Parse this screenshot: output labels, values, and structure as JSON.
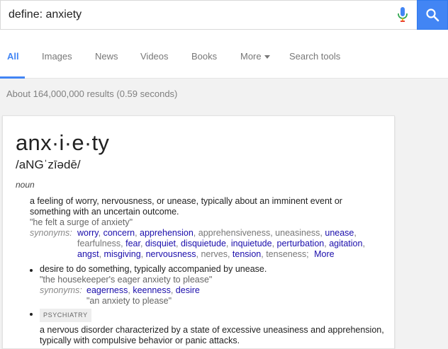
{
  "search": {
    "query": "define: anxiety"
  },
  "tabs": [
    {
      "label": "All",
      "active": true
    },
    {
      "label": "Images"
    },
    {
      "label": "News"
    },
    {
      "label": "Videos"
    },
    {
      "label": "Books"
    },
    {
      "label": "More"
    },
    {
      "label": "Search tools"
    }
  ],
  "stats": "About 164,000,000 results (0.59 seconds)",
  "definition": {
    "word": "anx·i·e·ty",
    "phonetic": "/aNGˈzīədē/",
    "part_of_speech": "noun",
    "senses": [
      {
        "text": "a feeling of worry, nervousness, or unease, typically about an imminent event or something with an uncertain outcome.",
        "example": "\"he felt a surge of anxiety\"",
        "synonyms_label": "synonyms:",
        "synonyms": [
          {
            "word": "worry",
            "link": true
          },
          {
            "word": "concern",
            "link": true
          },
          {
            "word": "apprehension",
            "link": true
          },
          {
            "word": "apprehensiveness",
            "link": false
          },
          {
            "word": "uneasiness",
            "link": false
          },
          {
            "word": "unease",
            "link": true
          },
          {
            "word": "fearfulness",
            "link": false
          },
          {
            "word": "fear",
            "link": true
          },
          {
            "word": "disquiet",
            "link": true
          },
          {
            "word": "disquietude",
            "link": true
          },
          {
            "word": "inquietude",
            "link": true
          },
          {
            "word": "perturbation",
            "link": true
          },
          {
            "word": "agitation",
            "link": true
          },
          {
            "word": "angst",
            "link": true
          },
          {
            "word": "misgiving",
            "link": true
          },
          {
            "word": "nervousness",
            "link": true
          },
          {
            "word": "nerves",
            "link": false
          },
          {
            "word": "tension",
            "link": true
          },
          {
            "word": "tenseness",
            "link": false
          }
        ],
        "more_label": "More"
      },
      {
        "text": "desire to do something, typically accompanied by unease.",
        "example": "\"the housekeeper's eager anxiety to please\"",
        "synonyms_label": "synonyms:",
        "synonyms": [
          {
            "word": "eagerness",
            "link": true
          },
          {
            "word": "keenness",
            "link": true
          },
          {
            "word": "desire",
            "link": true
          }
        ],
        "synonym_example": "\"an anxiety to please\""
      },
      {
        "label": "PSYCHIATRY",
        "text": "a nervous disorder characterized by a state of excessive uneasiness and apprehension, typically with compulsive behavior or panic attacks."
      }
    ]
  },
  "colors": {
    "accent": "#4285f4",
    "link": "#1a0dab",
    "mic_red": "#ea4335"
  }
}
